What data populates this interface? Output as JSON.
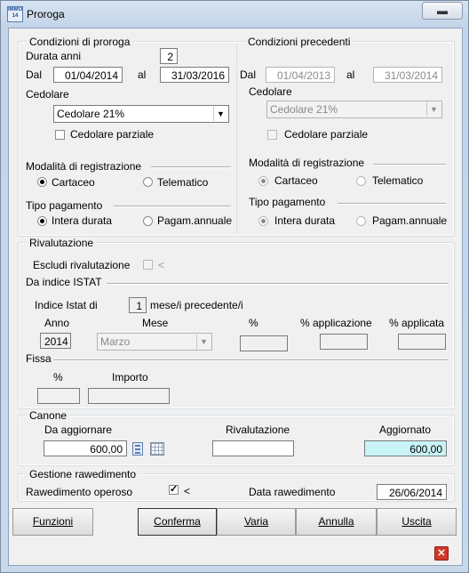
{
  "window": {
    "title": "Proroga",
    "app_icon_text": "IMMO 14",
    "minimize_glyph": "▬"
  },
  "condizioni_proroga": {
    "title": "Condizioni di proroga",
    "durata_label": "Durata anni",
    "durata_value": "2",
    "dal_label": "Dal",
    "dal_value": "01/04/2014",
    "al_label": "al",
    "al_value": "31/03/2016",
    "cedolare_label": "Cedolare",
    "cedolare_value": "Cedolare 21%",
    "cedolare_parziale": "Cedolare parziale",
    "modalita_label": "Modalità di registrazione",
    "cartaceo": "Cartaceo",
    "telematico": "Telematico",
    "tipo_pagamento_label": "Tipo pagamento",
    "intera_durata": "Intera durata",
    "pagam_annuale": "Pagam.annuale"
  },
  "condizioni_precedenti": {
    "title": "Condizioni precedenti",
    "dal_label": "Dal",
    "dal_value": "01/04/2013",
    "al_label": "al",
    "al_value": "31/03/2014",
    "cedolare_label": "Cedolare",
    "cedolare_value": "Cedolare 21%",
    "cedolare_parziale": "Cedolare parziale",
    "modalita_label": "Modalità di registrazione",
    "cartaceo": "Cartaceo",
    "telematico": "Telematico",
    "tipo_pagamento_label": "Tipo pagamento",
    "intera_durata": "Intera durata",
    "pagam_annuale": "Pagam.annuale"
  },
  "rivalutazione": {
    "title": "Rivalutazione",
    "escludi_label": "Escludi rivalutazione",
    "escludi_mark": "<",
    "da_indice_label": "Da indice ISTAT",
    "indice_istat_label": "Indice Istat di",
    "indice_value": "1",
    "mesi_label": "mese/i precedente/i",
    "col_anno": "Anno",
    "col_mese": "Mese",
    "col_perc": "%",
    "col_perc_applicazione": "% applicazione",
    "col_perc_applicata": "% applicata",
    "anno_value": "2014",
    "mese_value": "Marzo",
    "fissa_label": "Fissa",
    "fissa_col_perc": "%",
    "fissa_col_importo": "Importo"
  },
  "canone": {
    "title": "Canone",
    "da_aggiornare_label": "Da aggiornare",
    "da_aggiornare_value": "600,00",
    "rivalutazione_label": "Rivalutazione",
    "aggiornato_label": "Aggiornato",
    "aggiornato_value": "600,00"
  },
  "rawvedimento": {
    "title": "Gestione rawedimento",
    "operoso_label": "Rawedimento operoso",
    "operoso_mark": "<",
    "data_label": "Data rawedimento",
    "data_value": "26/06/2014"
  },
  "buttons": {
    "funzioni": "Funzioni",
    "conferma": "Conferma",
    "varia": "Varia",
    "annulla": "Annulla",
    "uscita": "Uscita"
  },
  "colors": {
    "title_bar": "#c9d9ec",
    "highlight_field": "#c8f4f8",
    "close_icon": "#d03a2a"
  }
}
